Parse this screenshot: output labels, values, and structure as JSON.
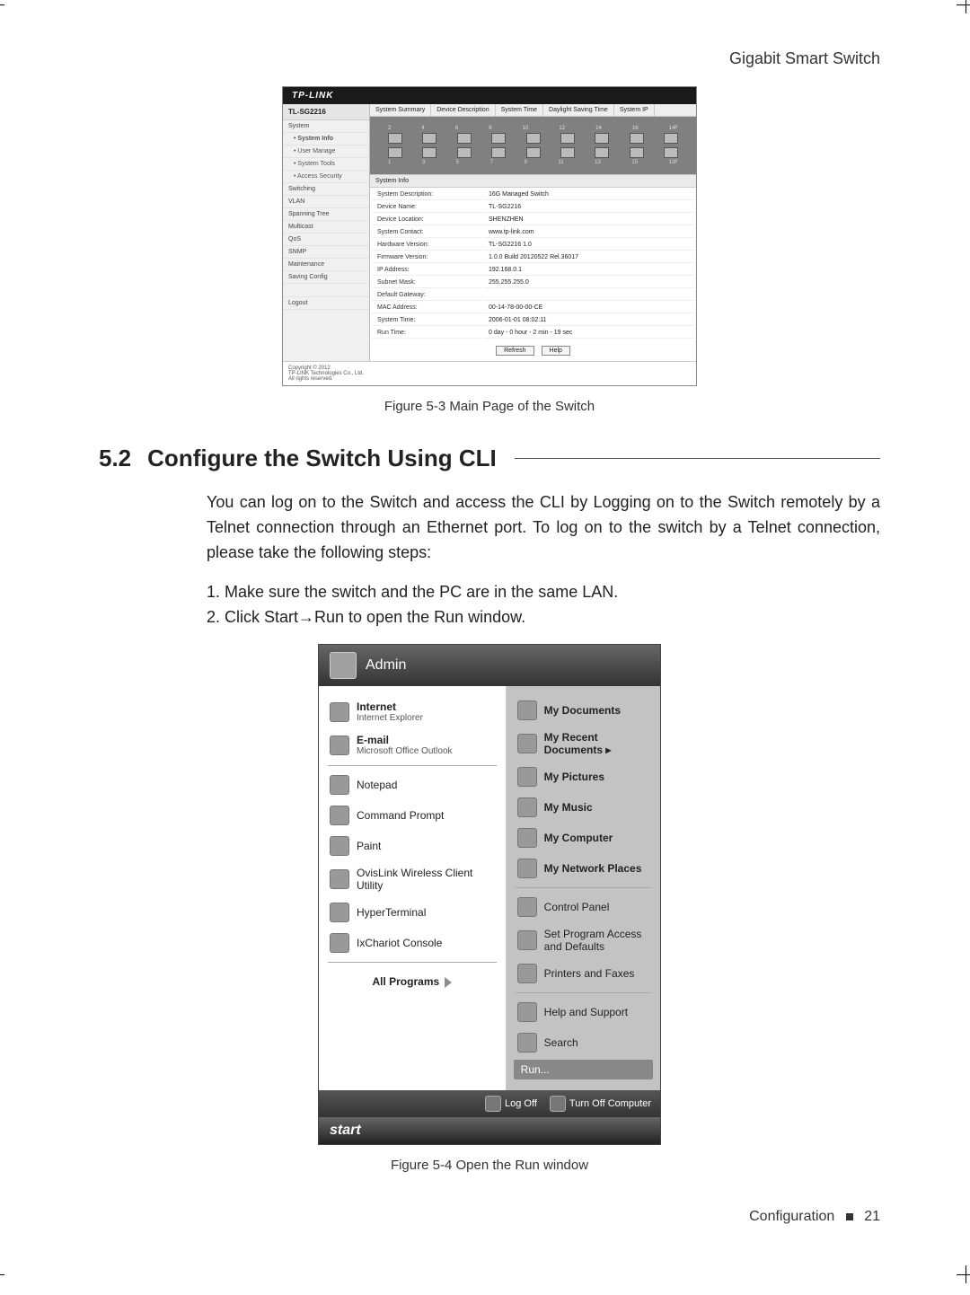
{
  "header": {
    "title": "Gigabit Smart Switch"
  },
  "switch_ui": {
    "brand": "TP-LINK",
    "model": "TL-SG2216",
    "sidebar": [
      "System",
      "• System Info",
      "• User Manage",
      "• System Tools",
      "• Access Security",
      "Switching",
      "VLAN",
      "Spanning Tree",
      "Multicast",
      "QoS",
      "SNMP",
      "Maintenance",
      "Saving Config",
      "",
      "Logout"
    ],
    "tabs": [
      "System Summary",
      "Device Description",
      "System Time",
      "Daylight Saving Time",
      "System IP"
    ],
    "port_labels_top": [
      "2",
      "4",
      "6",
      "8",
      "10",
      "12",
      "14",
      "16",
      "14F"
    ],
    "port_labels_bottom": [
      "1",
      "3",
      "5",
      "7",
      "9",
      "11",
      "13",
      "15",
      "13F"
    ],
    "info_header": "System Info",
    "info": [
      [
        "System Description:",
        "16G Managed Switch"
      ],
      [
        "Device Name:",
        "TL-SG2216"
      ],
      [
        "Device Location:",
        "SHENZHEN"
      ],
      [
        "System Contact:",
        "www.tp-link.com"
      ],
      [
        "Hardware Version:",
        "TL-SG2216 1.0"
      ],
      [
        "Firmware Version:",
        "1.0.0 Build 20120522 Rel.36017"
      ],
      [
        "IP Address:",
        "192.168.0.1"
      ],
      [
        "Subnet Mask:",
        "255.255.255.0"
      ],
      [
        "Default Gateway:",
        ""
      ],
      [
        "MAC Address:",
        "00-14-78-00-00-CE"
      ],
      [
        "System Time:",
        "2006-01-01 08:02:11"
      ],
      [
        "Run Time:",
        "0 day - 0 hour - 2 min - 19 sec"
      ]
    ],
    "buttons": [
      "Refresh",
      "Help"
    ],
    "copyright_lines": [
      "Copyright © 2012",
      "TP-LINK Technologies Co., Ltd.",
      "All rights reserved."
    ]
  },
  "fig1": "Figure 5-3  Main Page of the Switch",
  "section": {
    "num": "5.2",
    "title": "Configure the Switch Using CLI"
  },
  "para": "You can log on to the Switch and access the CLI by Logging on to the Switch remotely by a Telnet connection through an Ethernet port. To log on to the switch by a Telnet connection, please take the following steps:",
  "step1": "1. Make sure the switch and the PC are in the same LAN.",
  "step2": "2. Click Start→Run to open the Run window.",
  "startmenu": {
    "user": "Admin",
    "left_pinned": [
      {
        "title": "Internet",
        "sub": "Internet Explorer"
      },
      {
        "title": "E-mail",
        "sub": "Microsoft Office Outlook"
      }
    ],
    "left_items": [
      "Notepad",
      "Command Prompt",
      "Paint",
      "OvisLink Wireless Client Utility",
      "HyperTerminal",
      "IxChariot Console"
    ],
    "all_programs": "All Programs",
    "right_top": [
      "My Documents",
      "My Recent Documents   ▸",
      "My Pictures",
      "My Music",
      "My Computer",
      "My Network Places"
    ],
    "right_mid": [
      "Control Panel",
      "Set Program Access and Defaults",
      "Printers and Faxes"
    ],
    "right_bot": [
      "Help and Support",
      "Search",
      "Run..."
    ],
    "logoff": "Log Off",
    "turnoff": "Turn Off Computer",
    "start": "start"
  },
  "fig2": "Figure 5-4  Open the Run window",
  "footer": {
    "label": "Configuration",
    "page": "21"
  }
}
